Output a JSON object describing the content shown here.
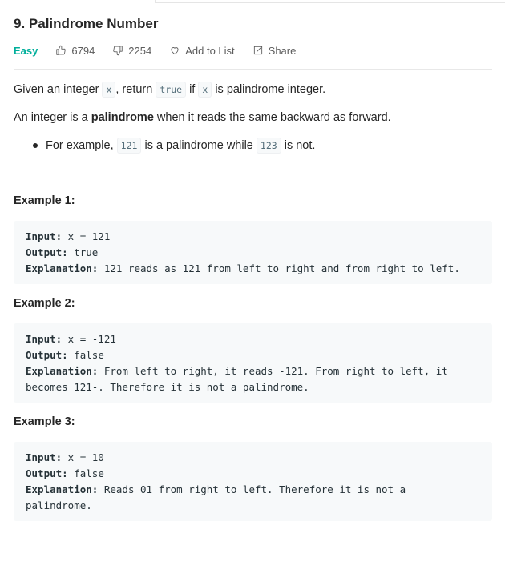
{
  "problem": {
    "title": "9. Palindrome Number",
    "difficulty": "Easy",
    "likes": "6794",
    "dislikes": "2254",
    "add_to_list": "Add to List",
    "share": "Share"
  },
  "description": {
    "line1": {
      "a": "Given an integer ",
      "code1": "x",
      "b": ", return ",
      "code2": "true",
      "c": " if ",
      "code3": "x",
      "d": " is palindrome integer."
    },
    "line2": {
      "a": "An integer is a ",
      "bold": "palindrome",
      "b": " when it reads the same backward as forward."
    },
    "bullet": {
      "a": "For example, ",
      "code1": "121",
      "b": " is a palindrome while ",
      "code2": "123",
      "c": " is not."
    }
  },
  "examples": [
    {
      "title": "Example 1:",
      "input_label": "Input:",
      "input": " x = 121",
      "output_label": "Output:",
      "output": " true",
      "explanation_label": "Explanation:",
      "explanation": " 121 reads as 121 from left to right and from right to left.",
      "explanation2": ""
    },
    {
      "title": "Example 2:",
      "input_label": "Input:",
      "input": " x = -121",
      "output_label": "Output:",
      "output": " false",
      "explanation_label": "Explanation:",
      "explanation": " From left to right, it reads -121. From right to left, it",
      "explanation2": "becomes 121-. Therefore it is not a palindrome."
    },
    {
      "title": "Example 3:",
      "input_label": "Input:",
      "input": " x = 10",
      "output_label": "Output:",
      "output": " false",
      "explanation_label": "Explanation:",
      "explanation": " Reads 01 from right to left. Therefore it is not a",
      "explanation2": "palindrome."
    }
  ],
  "colors": {
    "easy": "#00af9b",
    "code_bg": "#f7f9fa"
  },
  "icons": {
    "likes": "thumbs-up-icon",
    "dislikes": "thumbs-down-icon",
    "add_to_list": "heart-icon",
    "share": "share-icon"
  }
}
